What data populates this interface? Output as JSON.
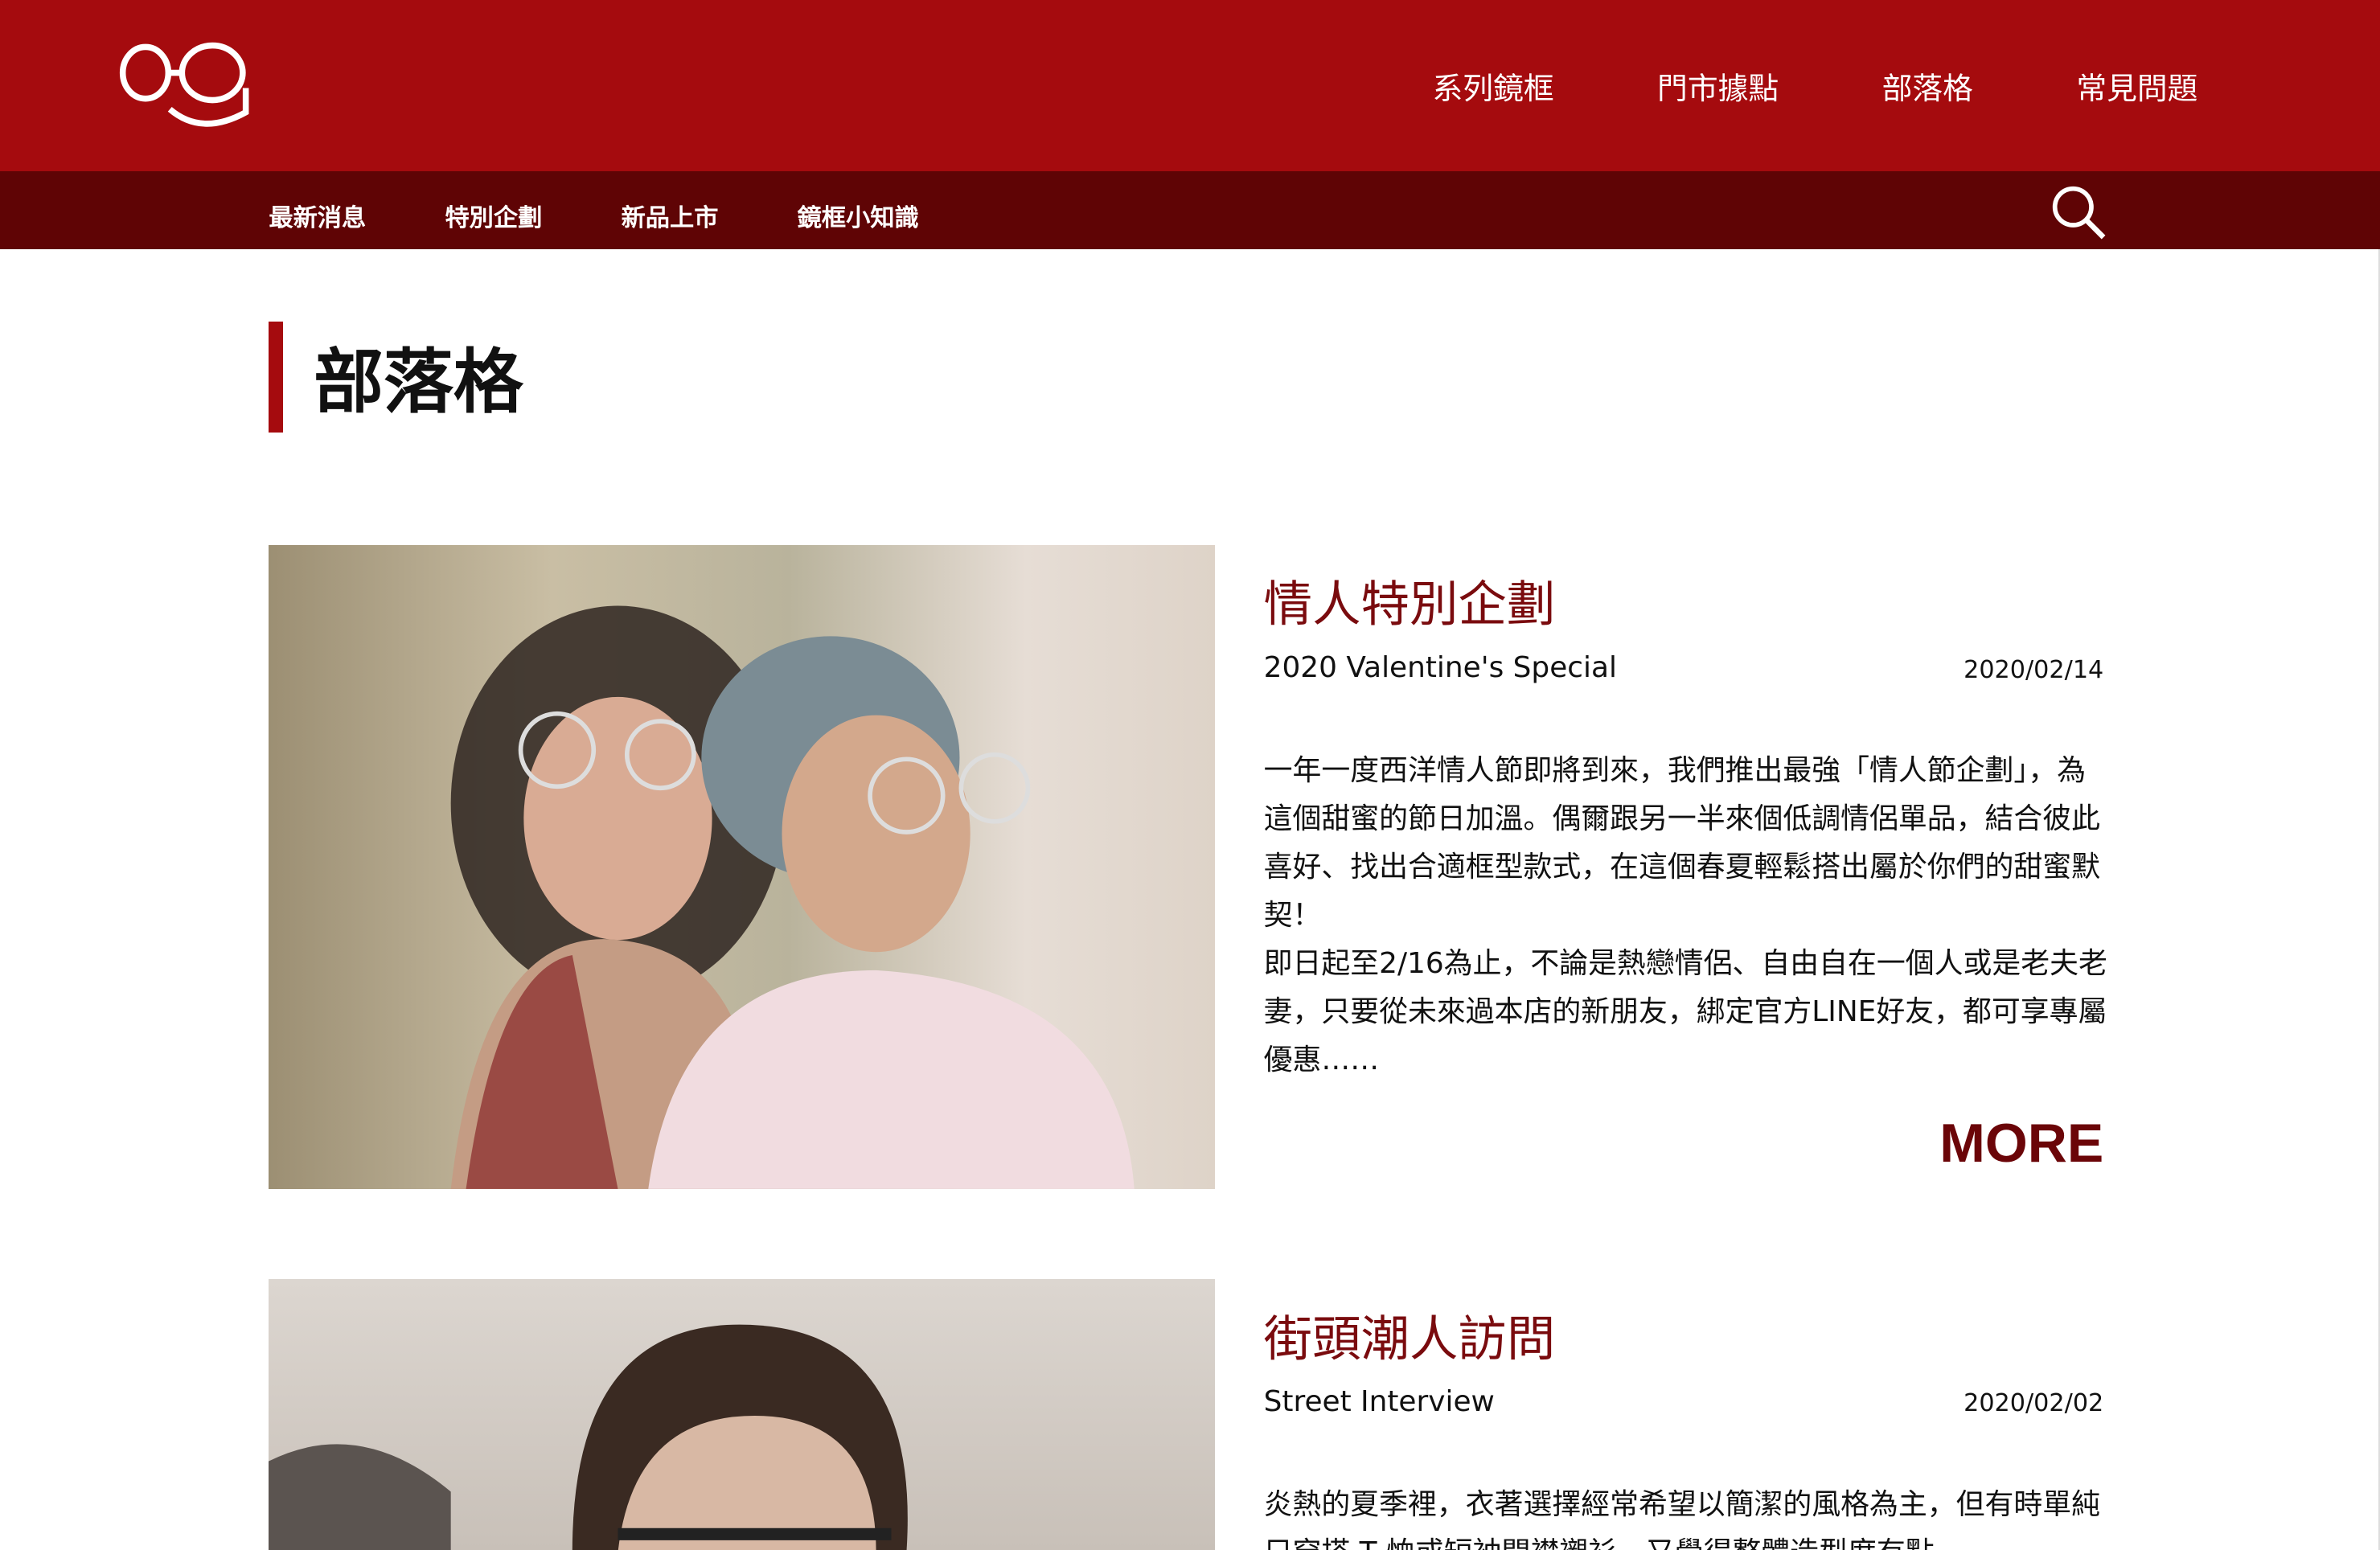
{
  "header": {
    "logo_icon": "glasses-smile-logo",
    "nav": [
      "系列鏡框",
      "門市據點",
      "部落格",
      "常見問題"
    ]
  },
  "subnav": {
    "items": [
      "最新消息",
      "特別企劃",
      "新品上市",
      "鏡框小知識"
    ],
    "search_icon": "search-icon"
  },
  "page": {
    "title": "部落格"
  },
  "articles": [
    {
      "title": "情人特別企劃",
      "subtitle": "2020 Valentine's Special",
      "date": "2020/02/14",
      "body": "一年一度西洋情人節即將到來，我們推出最強「情人節企劃」，為這個甜蜜的節日加溫。偶爾跟另一半來個低調情侶單品，結合彼此喜好、找出合適框型款式，在這個春夏輕鬆搭出屬於你們的甜蜜默契！",
      "body2": "即日起至2/16為止，不論是熱戀情侶、自由自在一個人或是老夫老妻，只要從未來過本店的新朋友，綁定官方LINE好友，都可享專屬優惠……",
      "more": "MORE"
    },
    {
      "title": "街頭潮人訪問",
      "subtitle": "Street Interview",
      "date": "2020/02/02",
      "body": "炎熱的夏季裡，衣著選擇經常希望以簡潔的風格為主，但有時單純只穿搭 T 恤或短袖開襟襯衫，又覺得整體造型度有點"
    }
  ]
}
